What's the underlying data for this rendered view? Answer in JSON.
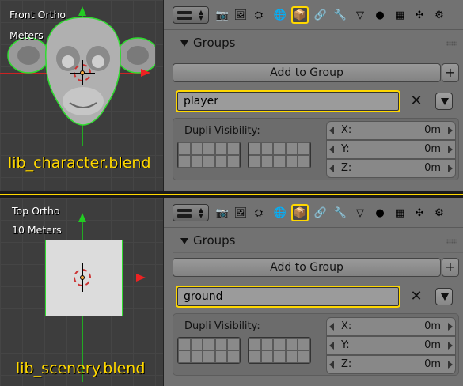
{
  "top": {
    "viewport": {
      "view_label": "Front Ortho",
      "units_label": "Meters",
      "filename": "lib_character.blend"
    },
    "props": {
      "tabs": [
        "render-icon",
        "render-layers-icon",
        "scene-icon",
        "world-icon",
        "object-icon",
        "constraints-icon",
        "modifiers-icon",
        "data-icon",
        "material-icon",
        "texture-icon",
        "particles-icon",
        "physics-icon"
      ],
      "active_tab": "object-icon",
      "panel_title": "Groups",
      "add_label": "Add to Group",
      "plus_label": "+",
      "group_name": "player",
      "remove_label": "✕",
      "dupli_label": "Dupli Visibility:",
      "coords": [
        {
          "axis": "X:",
          "value": "0m"
        },
        {
          "axis": "Y:",
          "value": "0m"
        },
        {
          "axis": "Z:",
          "value": "0m"
        }
      ]
    }
  },
  "bottom": {
    "viewport": {
      "view_label": "Top Ortho",
      "units_label": "10 Meters",
      "filename": "lib_scenery.blend"
    },
    "props": {
      "tabs": [
        "render-icon",
        "render-layers-icon",
        "scene-icon",
        "world-icon",
        "object-icon",
        "constraints-icon",
        "modifiers-icon",
        "data-icon",
        "material-icon",
        "texture-icon",
        "particles-icon",
        "physics-icon"
      ],
      "active_tab": "object-icon",
      "panel_title": "Groups",
      "add_label": "Add to Group",
      "plus_label": "+",
      "group_name": "ground",
      "remove_label": "✕",
      "dupli_label": "Dupli Visibility:",
      "coords": [
        {
          "axis": "X:",
          "value": "0m"
        },
        {
          "axis": "Y:",
          "value": "0m"
        },
        {
          "axis": "Z:",
          "value": "0m"
        }
      ]
    }
  },
  "colors": {
    "highlight": "#ffd800",
    "panel_bg": "#727272",
    "viewport_bg": "#3d3d3d"
  }
}
